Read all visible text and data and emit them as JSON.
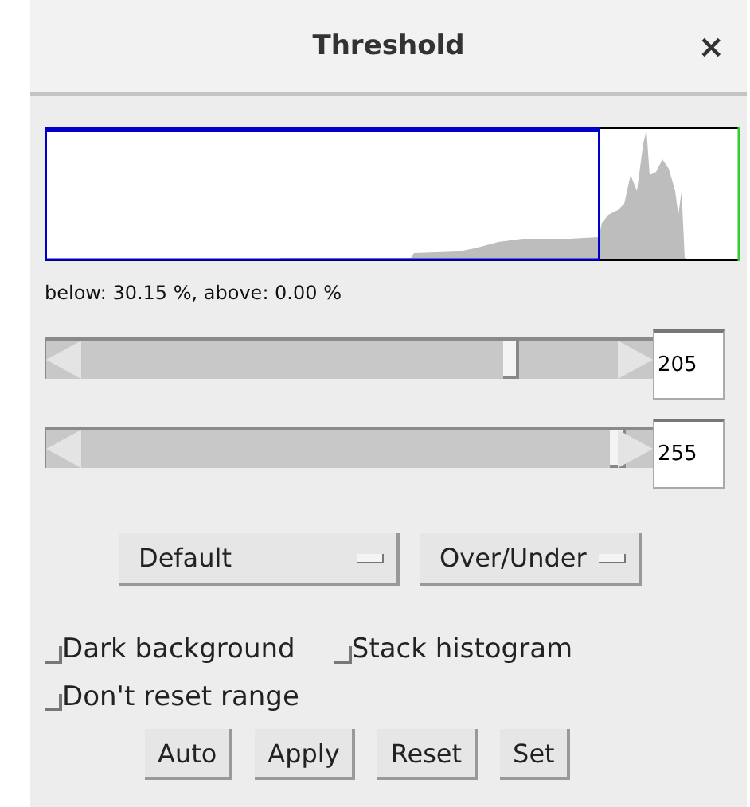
{
  "window": {
    "title": "Threshold",
    "close": "×"
  },
  "readout": "below: 30.15 %,  above: 0.00 %",
  "sliders": [
    {
      "level": 0.8,
      "value": "205"
    },
    {
      "level": 1.0,
      "value": "255"
    }
  ],
  "dropdowns": [
    {
      "value": "Default"
    },
    {
      "value": "Over/Under"
    }
  ],
  "checkboxes": [
    {
      "label": "Dark background",
      "checked": false
    },
    {
      "label": "Stack histogram",
      "checked": false
    },
    {
      "label": "Don't reset range",
      "checked": false
    }
  ],
  "buttons": [
    "Auto",
    "Apply",
    "Reset",
    "Set"
  ]
}
